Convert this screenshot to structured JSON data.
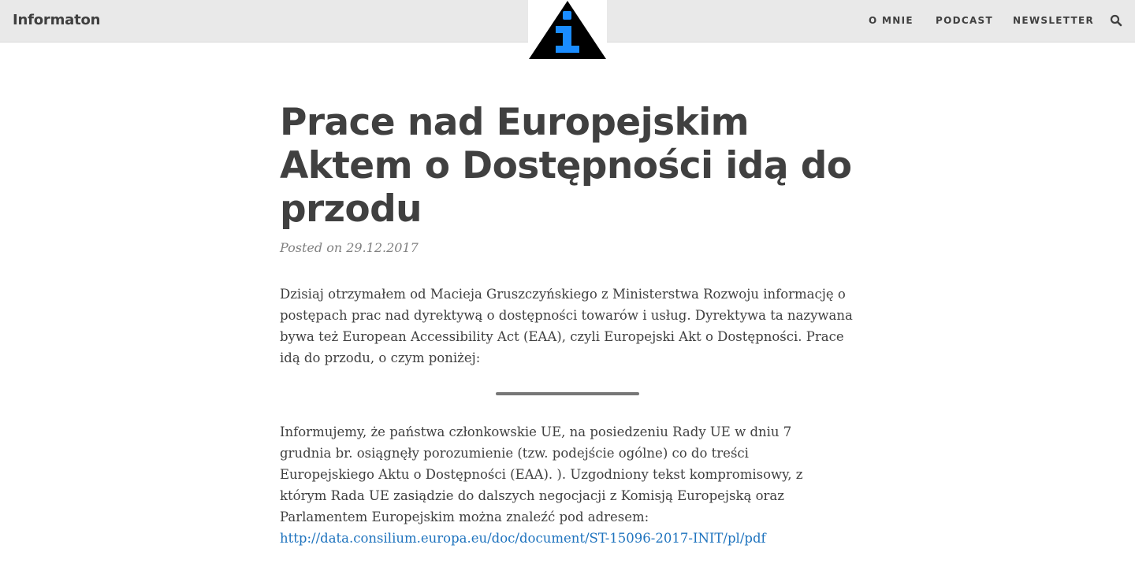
{
  "header": {
    "brand": "Informaton",
    "logo_icon": "info-icon",
    "nav": [
      {
        "label": "O MNIE"
      },
      {
        "label": "PODCAST"
      },
      {
        "label": "NEWSLETTER"
      }
    ],
    "search_icon": "search-icon"
  },
  "post": {
    "title": "Prace nad Europejskim Aktem o Dostępności idą do przodu",
    "meta": "Posted on 29.12.2017",
    "paragraph1": "Dzisiaj otrzymałem od Macieja Gruszczyńskiego z Ministerstwa Rozwoju informację o postępach prac nad dyrektywą o dostępności towarów i usług. Dyrektywa ta nazywana bywa też European Accessibility Act (EAA), czyli Europejski Akt o Dostępności. Prace idą do przodu, o czym poniżej:",
    "paragraph2_text": "Informujemy, że państwa członkowskie UE, na posiedzeniu Rady UE w dniu 7 grudnia br. osiągnęły porozumienie (tzw. podejście ogólne) co do treści Europejskiego Aktu o Dostępności (EAA). ). Uzgodniony tekst kompromisowy, z którym Rada UE zasiądzie do dalszych negocjacji z Komisją Europejską oraz Parlamentem Europejskim można znaleźć pod adresem: ",
    "paragraph2_link": "http://data.consilium.europa.eu/doc/document/ST-15096-2017-INIT/pl/pdf"
  },
  "colors": {
    "navbar_bg": "#e9e9e9",
    "text": "#404040",
    "meta": "#808080",
    "link": "#1e73be",
    "logo_triangle": "#000000",
    "logo_info": "#1a8cff"
  }
}
